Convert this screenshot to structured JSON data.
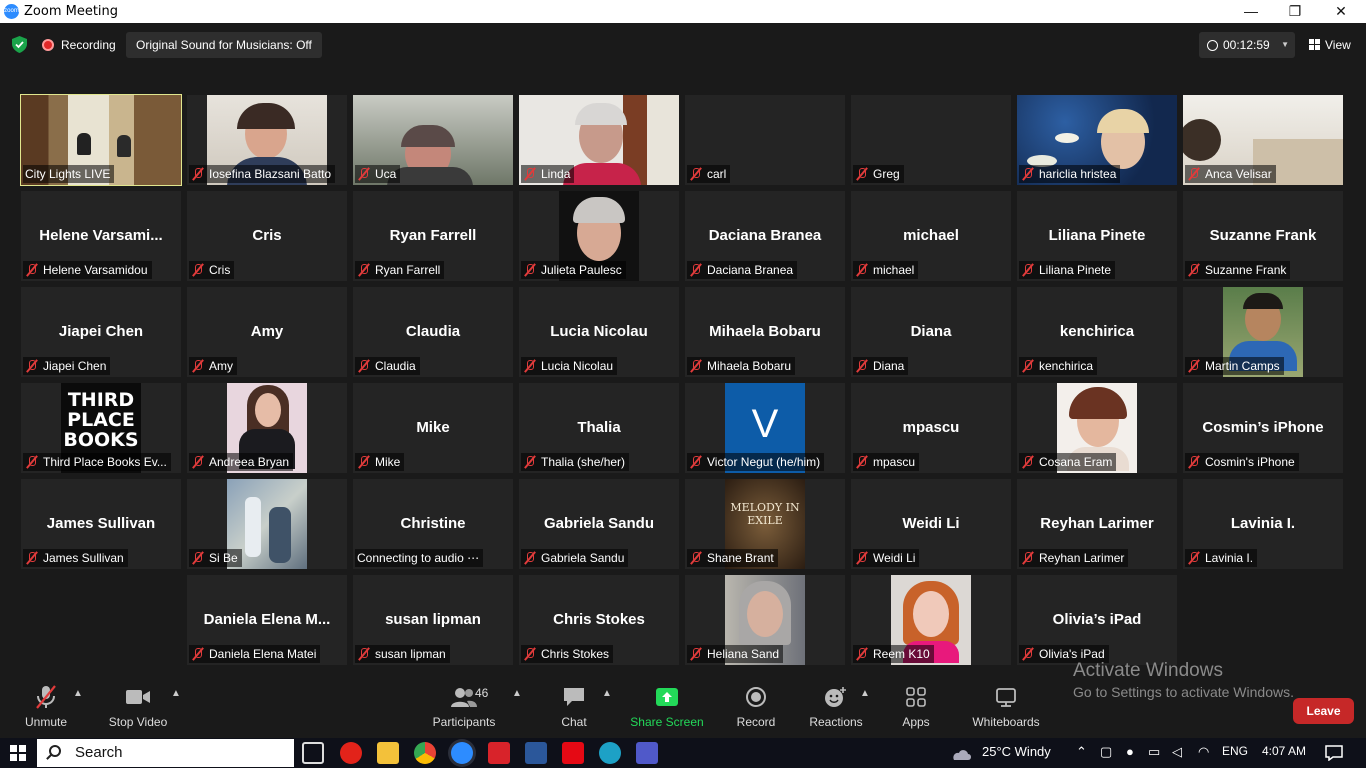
{
  "window": {
    "title": "Zoom Meeting",
    "minimize": "—",
    "restore": "❐",
    "close": "✕"
  },
  "topbar": {
    "recording": "Recording",
    "sound": "Original Sound for Musicians: Off",
    "timer": "00:12:59",
    "view": "View",
    "colors": {
      "shield": "#1aa34a",
      "record": "#e02828"
    }
  },
  "tiles": [
    {
      "r": 0,
      "c": 0,
      "label": "City Lights LIVE",
      "video": "city",
      "muted": false,
      "speaking": true
    },
    {
      "r": 0,
      "c": 1,
      "label": "Iosefina Blazsani Batto",
      "video": "woman1",
      "muted": true
    },
    {
      "r": 0,
      "c": 2,
      "label": "Uca",
      "video": "uca",
      "muted": true
    },
    {
      "r": 0,
      "c": 3,
      "label": "Linda",
      "video": "linda",
      "muted": true
    },
    {
      "r": 0,
      "c": 4,
      "label": "carl",
      "muted": true
    },
    {
      "r": 0,
      "c": 5,
      "label": "Greg",
      "muted": true
    },
    {
      "r": 0,
      "c": 6,
      "label": "hariclia hristea",
      "video": "lilies",
      "muted": true
    },
    {
      "r": 0,
      "c": 7,
      "label": "Anca Velisar",
      "video": "room",
      "muted": true
    },
    {
      "r": 1,
      "c": 0,
      "name": "Helene Varsami...",
      "label": "Helene Varsamidou",
      "muted": true
    },
    {
      "r": 1,
      "c": 1,
      "name": "Cris",
      "label": "Cris",
      "muted": true
    },
    {
      "r": 1,
      "c": 2,
      "name": "Ryan Farrell",
      "label": "Ryan Farrell",
      "muted": true
    },
    {
      "r": 1,
      "c": 3,
      "label": "Julieta Paulesc",
      "video": "julieta",
      "muted": true
    },
    {
      "r": 1,
      "c": 4,
      "name": "Daciana Branea",
      "label": "Daciana Branea",
      "muted": true
    },
    {
      "r": 1,
      "c": 5,
      "name": "michael",
      "label": "michael",
      "muted": true
    },
    {
      "r": 1,
      "c": 6,
      "name": "Liliana Pinete",
      "label": "Liliana Pinete",
      "muted": true
    },
    {
      "r": 1,
      "c": 7,
      "name": "Suzanne Frank",
      "label": "Suzanne Frank",
      "muted": true
    },
    {
      "r": 2,
      "c": 0,
      "name": "Jiapei Chen",
      "label": "Jiapei Chen",
      "muted": true
    },
    {
      "r": 2,
      "c": 1,
      "name": "Amy",
      "label": "Amy",
      "muted": true
    },
    {
      "r": 2,
      "c": 2,
      "name": "Claudia",
      "label": "Claudia",
      "muted": true
    },
    {
      "r": 2,
      "c": 3,
      "name": "Lucia Nicolau",
      "label": "Lucia Nicolau",
      "muted": true
    },
    {
      "r": 2,
      "c": 4,
      "name": "Mihaela Bobaru",
      "label": "Mihaela Bobaru",
      "muted": true
    },
    {
      "r": 2,
      "c": 5,
      "name": "Diana",
      "label": "Diana",
      "muted": true
    },
    {
      "r": 2,
      "c": 6,
      "name": "kenchirica",
      "label": "kenchirica",
      "muted": true
    },
    {
      "r": 2,
      "c": 7,
      "label": "Martin Camps",
      "video": "martin",
      "muted": true
    },
    {
      "r": 3,
      "c": 0,
      "label": "Third Place Books Ev...",
      "video": "books",
      "muted": true
    },
    {
      "r": 3,
      "c": 1,
      "label": "Andreea Bryan",
      "video": "andreea",
      "muted": true
    },
    {
      "r": 3,
      "c": 2,
      "name": "Mike",
      "label": "Mike",
      "muted": true
    },
    {
      "r": 3,
      "c": 3,
      "name": "Thalia",
      "label": "Thalia (she/her)",
      "muted": true
    },
    {
      "r": 3,
      "c": 4,
      "label": "Victor Negut (he/him)",
      "video": "v",
      "muted": true
    },
    {
      "r": 3,
      "c": 5,
      "name": "mpascu",
      "label": "mpascu",
      "muted": true
    },
    {
      "r": 3,
      "c": 6,
      "label": "Cosana Eram",
      "video": "cosana",
      "muted": true
    },
    {
      "r": 3,
      "c": 7,
      "name": "Cosmin’s iPhone",
      "label": "Cosmin's iPhone",
      "muted": true
    },
    {
      "r": 4,
      "c": 0,
      "name": "James Sullivan",
      "label": "James Sullivan",
      "muted": true
    },
    {
      "r": 4,
      "c": 1,
      "label": "Si Be",
      "video": "painting",
      "muted": true
    },
    {
      "r": 4,
      "c": 2,
      "name": "Christine",
      "label": "Connecting to audio ⋯",
      "muted": false
    },
    {
      "r": 4,
      "c": 3,
      "name": "Gabriela Sandu",
      "label": "Gabriela Sandu",
      "muted": true
    },
    {
      "r": 4,
      "c": 4,
      "label": "Shane Brant",
      "video": "melody",
      "muted": true
    },
    {
      "r": 4,
      "c": 5,
      "name": "Weidi Li",
      "label": "Weidi Li",
      "muted": true
    },
    {
      "r": 4,
      "c": 6,
      "name": "Reyhan Larimer",
      "label": "Reyhan Larimer",
      "muted": true
    },
    {
      "r": 4,
      "c": 7,
      "name": "Lavinia I.",
      "label": "Lavinia I.",
      "muted": true
    },
    {
      "r": 5,
      "c": 1,
      "name": "Daniela Elena M...",
      "label": "Daniela Elena Matei",
      "muted": true
    },
    {
      "r": 5,
      "c": 2,
      "name": "susan lipman",
      "label": "susan lipman",
      "muted": true
    },
    {
      "r": 5,
      "c": 3,
      "name": "Chris Stokes",
      "label": "Chris Stokes",
      "muted": true
    },
    {
      "r": 5,
      "c": 4,
      "label": "Heliana Sand",
      "video": "heliana",
      "muted": true
    },
    {
      "r": 5,
      "c": 5,
      "label": "Reem K10",
      "video": "reem",
      "muted": true
    },
    {
      "r": 5,
      "c": 6,
      "name": "Olivia’s iPad",
      "label": "Olivia's iPad",
      "muted": true
    }
  ],
  "video_text": {
    "books": "THIRD PLACE BOOKS",
    "v": "V",
    "melody": "MELODY IN EXILE"
  },
  "toolbar": {
    "unmute": "Unmute",
    "stop_video": "Stop Video",
    "participants": "Participants",
    "participant_count": "46",
    "chat": "Chat",
    "share": "Share Screen",
    "record": "Record",
    "reactions": "Reactions",
    "apps": "Apps",
    "whiteboards": "Whiteboards",
    "leave": "Leave",
    "share_color": "#23d959",
    "leave_color": "#c62828"
  },
  "watermark": {
    "line1": "Activate Windows",
    "line2": "Go to Settings to activate Windows."
  },
  "taskbar": {
    "search": "Search",
    "weather": "25°C  Windy",
    "lang": "ENG",
    "time": "4:07 AM"
  }
}
